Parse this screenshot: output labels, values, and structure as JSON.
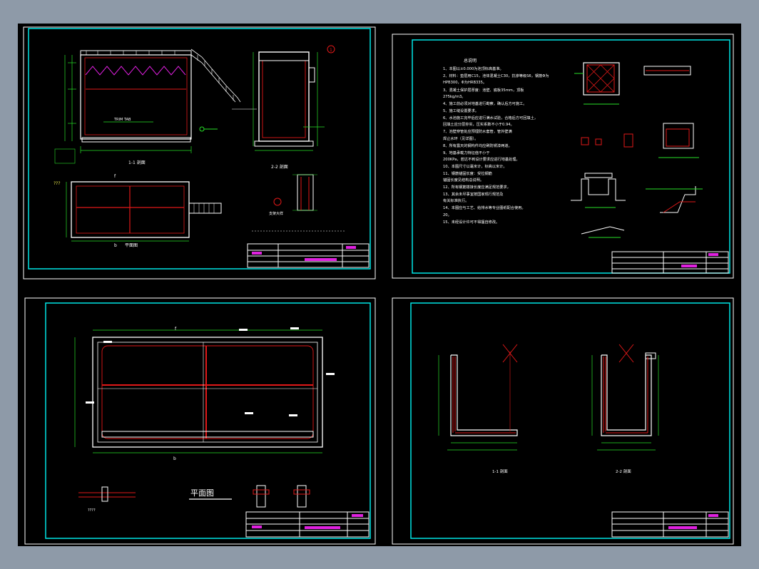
{
  "colors": {
    "background": "#8e9aa8",
    "canvas": "#000000",
    "sheet_border": "#00e6e6",
    "sheet_inner": "#ffffff",
    "rebar": "#e01818",
    "dim": "#27e027",
    "magenta": "#e020e0",
    "yellow": "#e8e84a",
    "text": "#ffffff"
  },
  "sheet1": {
    "section1_label": "1-1 剖面",
    "section2_label": "2-2 剖面",
    "plan_label": "平面图",
    "marker_b": "b",
    "marker_f": "f",
    "question": "???",
    "circle_tag": "1"
  },
  "sheet2": {
    "title": "总说明",
    "notes": [
      "1、本图以±0.000为池顶标高基准。",
      "2、材料：垫层用C15，池体混凝土C30，抗渗等级S6，钢筋Φ为",
      "HPB300，Φ为HRB335。",
      "3、混凝土保护层厚度：池壁、底板35mm，顶板",
      "275kg/m3。",
      "4、施工前必须对地基进行勘察，确认后方可施工。",
      "5、施工缝设置要求。",
      "6、水池施工完毕后应进行满水试验，合格后方可回填土，",
      "回填土应分层夯实，压实系数不小于0.94。",
      "7、池壁穿管处应预埋防水套管，管外壁满",
      "焊止水环（见详图）。",
      "8、所有露天的钢构件均应刷防锈漆两道。",
      "9、地基承载力特征值不小于",
      "200KPa，若达不到设计要求应进行地基处理。",
      "10、本图尺寸以毫米计，标高以米计。",
      "11、钢筋锚固长度：受拉钢筋",
      "锚固长度见结构总说明。",
      "12、所有钢筋搭接长度应满足规范要求，",
      "13、其余未尽事宜按国家现行规范及",
      "有关标准执行。",
      "14、本图应与工艺、给排水等专业图纸配合使用。",
      "20。",
      "15、未经设计许可不得擅自修改。"
    ]
  },
  "sheet3": {
    "plan_title": "平面图",
    "marker_f": "f",
    "marker_b": "b"
  },
  "sheet4": {
    "section1_label": "1-1 剖面",
    "section2_label": "2-2 剖面"
  }
}
